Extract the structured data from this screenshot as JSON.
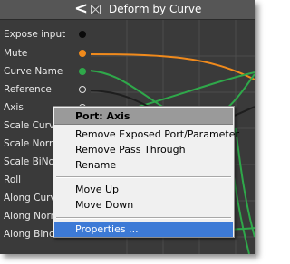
{
  "titlebar": {
    "collapse_glyph": "<",
    "checkbox_icon": "checkbox-x-icon",
    "title": "Deform by Curve"
  },
  "ports": [
    {
      "label": "Expose input",
      "dot": "filled-black"
    },
    {
      "label": "Mute",
      "dot": "orange"
    },
    {
      "label": "Curve Name",
      "dot": "green"
    },
    {
      "label": "Reference",
      "dot": "hollow"
    },
    {
      "label": "Axis",
      "dot": "hollow"
    },
    {
      "label": "Scale Curve",
      "dot": ""
    },
    {
      "label": "Scale Norm",
      "dot": ""
    },
    {
      "label": "Scale BiNor",
      "dot": ""
    },
    {
      "label": "Roll",
      "dot": ""
    },
    {
      "label": "Along Curve",
      "dot": ""
    },
    {
      "label": "Along Norm",
      "dot": ""
    },
    {
      "label": "Along Binor",
      "dot": ""
    }
  ],
  "context_menu": {
    "header": "Port: Axis",
    "items_group1": [
      "Remove Exposed Port/Parameter",
      "Remove Pass Through",
      "Rename"
    ],
    "items_group2": [
      "Move Up",
      "Move Down"
    ],
    "items_group3": [
      "Properties ..."
    ],
    "selected": "Properties ..."
  },
  "colors": {
    "panel_bg": "#3a3a3a",
    "titlebar_bg": "#565656",
    "menu_bg": "#f0f0f0",
    "menu_header_bg": "#9a9a9a",
    "selection": "#3d7ad6",
    "wire_orange": "#f08a1c",
    "wire_green": "#2fa84a",
    "wire_dark": "#1e1e1e"
  }
}
